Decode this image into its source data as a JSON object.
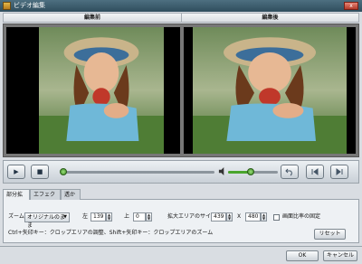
{
  "window": {
    "title": "ビデオ編集",
    "close_label": "x"
  },
  "preview": {
    "before_label": "編集前",
    "after_label": "編集後"
  },
  "playback": {
    "play_symbol": "▶",
    "stop_symbol": "■",
    "seek_progress": 0.02,
    "volume_level": 0.45
  },
  "control_icons": [
    "play-icon",
    "stop-icon",
    "speaker-icon",
    "undo-icon",
    "prev-frame-icon",
    "next-frame-icon"
  ],
  "tabs": [
    {
      "label": "部分拡大",
      "active": true
    },
    {
      "label": "エフェクト",
      "active": false
    },
    {
      "label": "透かし",
      "active": false
    }
  ],
  "crop": {
    "zoom_label": "ズーム",
    "zoom_value": "オリジナルのまま",
    "left_label": "左",
    "left_value": "139",
    "top_label": "上",
    "top_value": "0",
    "area_size_label": "拡大エリアのサイズ",
    "width_value": "439",
    "times_label": "X",
    "height_value": "480",
    "aspect_label": "画面比率の固定",
    "aspect_checked": false,
    "hint": "Ctrl+矢印キー：クロップエリアの調整、Shift+矢印キー：クロップエリアのズーム",
    "reset_label": "リセット"
  },
  "footer": {
    "ok_label": "OK",
    "cancel_label": "キャンセル"
  },
  "colors": {
    "titlebar": "#3c5c6c",
    "preview_bg": "#777777",
    "accent_green": "#49a52c"
  }
}
